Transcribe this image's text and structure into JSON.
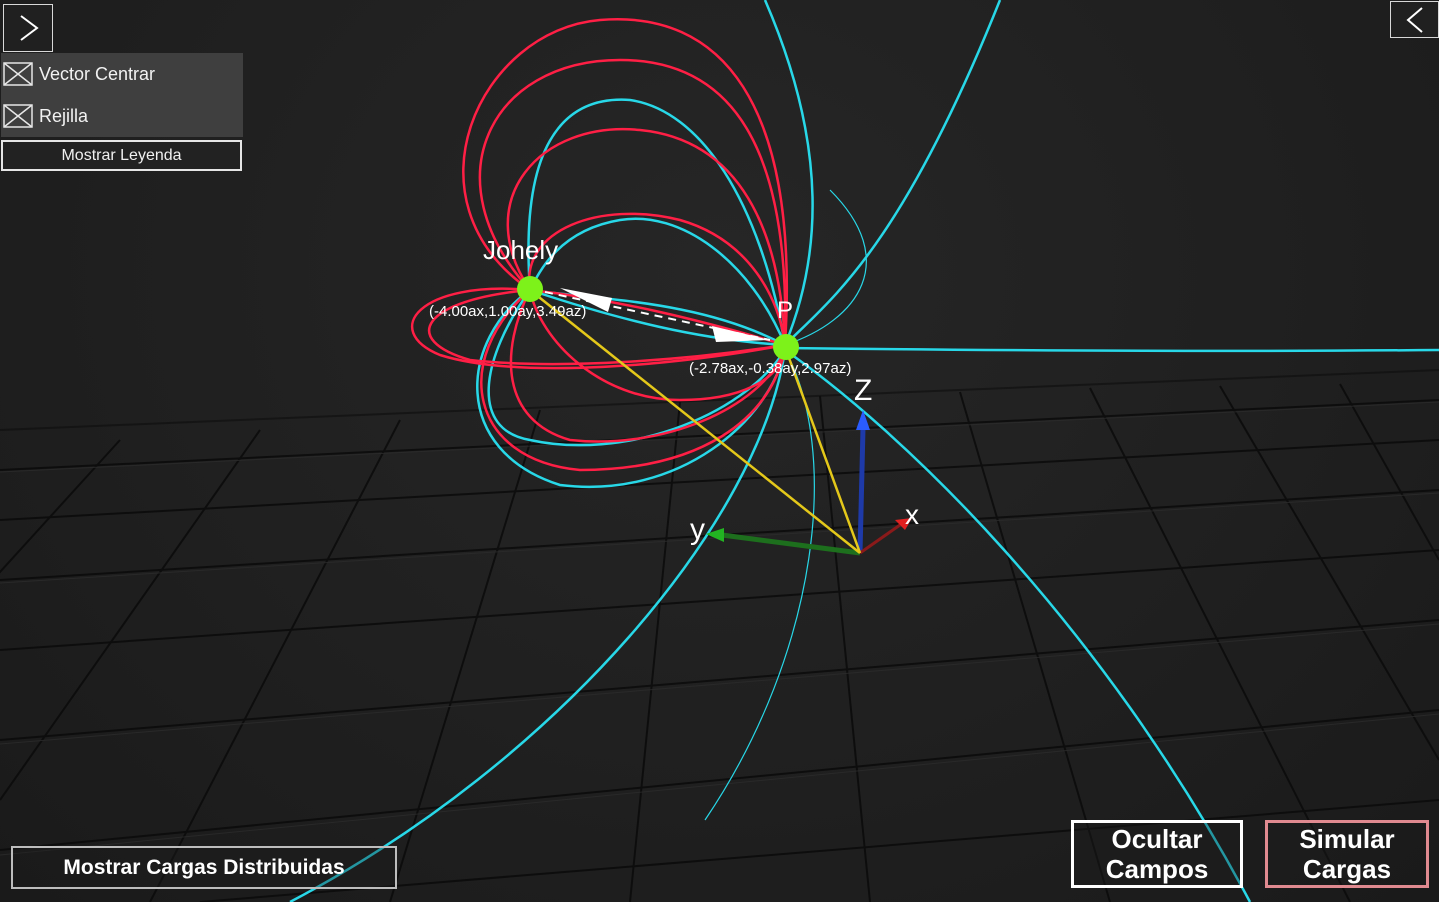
{
  "nav": {
    "open_panel_icon": "chevron-right-icon",
    "close_panel_icon": "chevron-left-icon"
  },
  "options_panel": {
    "vector_centrar": {
      "label": "Vector Centrar",
      "checked": true
    },
    "rejilla": {
      "label": "Rejilla",
      "checked": true
    },
    "legend_button": "Mostrar Leyenda"
  },
  "scene": {
    "charges": [
      {
        "name": "Johely",
        "coords": "(-4.00ax,1.00ay,3.49az)"
      },
      {
        "name": "P",
        "coords": "(-2.78ax,-0.38ay,2.97az)"
      }
    ],
    "axes": {
      "x": "x",
      "y": "y",
      "z": "Z"
    }
  },
  "buttons": {
    "mostrar_cargas_distribuidas": "Mostrar Cargas Distribuidas",
    "ocultar_line1": "Ocultar",
    "ocultar_line2": "Campos",
    "simular_line1": "Simular",
    "simular_line2": "Cargas"
  },
  "colors": {
    "field_line_a": "#ff1f45",
    "field_line_b": "#28d8e8",
    "charge": "#7df21a",
    "vector": "#e4c81a",
    "axis_x": "#e02020",
    "axis_y": "#22b522",
    "axis_z": "#2a5cff",
    "background": "#1e1e1e"
  }
}
